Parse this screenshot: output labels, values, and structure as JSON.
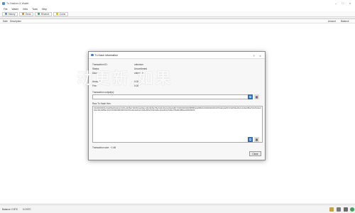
{
  "window": {
    "title": "Tx Hashes & Wallet"
  },
  "menubar": {
    "items": [
      "File",
      "Wallet",
      "View",
      "Tools",
      "Help"
    ]
  },
  "toolbar": {
    "buttons": [
      {
        "label": "History",
        "color": "#4a90d9"
      },
      {
        "label": "Send",
        "color": "#d98a2b"
      },
      {
        "label": "Receive",
        "color": "#3aa655"
      },
      {
        "label": "Coins",
        "color": "#f0b400"
      }
    ]
  },
  "table": {
    "col_date": "Date",
    "col_description": "Description",
    "col_amount": "Amount",
    "col_balance": "Balance"
  },
  "dialog": {
    "title": "Tx Hash Information",
    "rows": [
      {
        "label": "Transaction ID:",
        "value": "unknown"
      },
      {
        "label": "Status:",
        "value": "Unconfirmed"
      },
      {
        "label": "Date:",
        "value": "unknown"
      },
      {
        "label": "Amount:",
        "value": "0.00"
      },
      {
        "label": "Fee:",
        "value": "0.00"
      }
    ],
    "section_outputs": "Transaction output(s):",
    "section_raw": "Raw Tx Hash Hex:",
    "raw_hex": "0100000001c9a3f8e0b4d2a7c6f1e9b8a7d6c5b4a3f2e1d0c9b8a7f6e5d4c3b2a1f0e9d8c70000000000ffffffff02a0860100000000001976a914e8b7c6d5f4a3b2c1d0e9f8a7b6c5d4e3f2a1b0c988ac10270000000000001976a914a1b2c3d4e5f6a7b8c9d0e1f2a3b4c5d6e7f8a9b088ac00000000",
    "footer_label": "Transaction size: ~1 kB",
    "close_label": "Close"
  },
  "watermark": {
    "text": "动更新,如果"
  },
  "top_watermark": {
    "text": "。  ）"
  },
  "statusbar": {
    "left": "Balance: 0 BTC",
    "mid": "0.0 BTC"
  }
}
